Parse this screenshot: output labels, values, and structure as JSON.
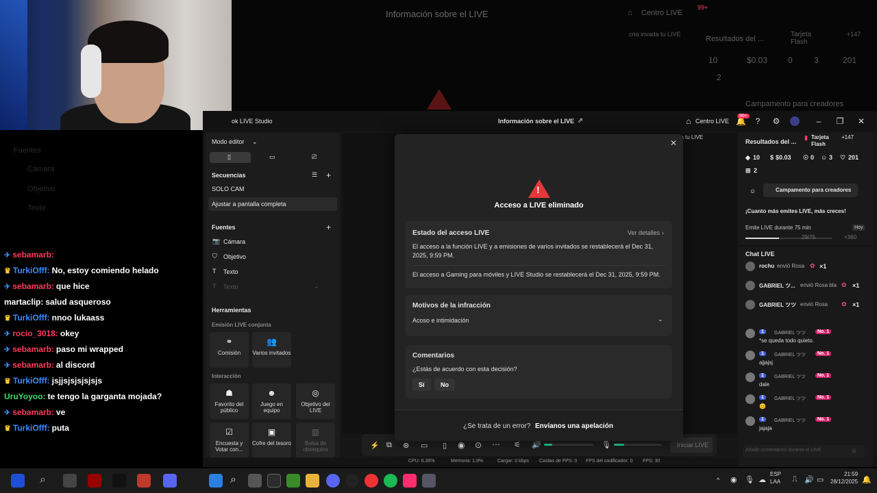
{
  "ghost": {
    "title": "Información sobre el LIVE",
    "centro": "Centro LIVE",
    "badge": "99+",
    "sub": "cria invada tu LIVE",
    "results": "Resultados del ...",
    "tarjeta": "Tarjeta Flash",
    "plus": "+147",
    "s1": "10",
    "s2": "$0.03",
    "s3": "0",
    "s4": "3",
    "s5": "201",
    "s6": "2",
    "camp": "Campamento para creadores"
  },
  "left_sources": {
    "title": "Fuentes",
    "items": [
      "Cámara",
      "Objetivo",
      "Texto"
    ]
  },
  "chat": [
    {
      "user": "sebamarb:",
      "msg": "",
      "icon": "✈",
      "color": "#ff3b5c"
    },
    {
      "user": "TurkiOfff:",
      "msg": "No, estoy comiendo helado",
      "icon": "♛",
      "color": "#3d8bff"
    },
    {
      "user": "sebamarb:",
      "msg": "que hice",
      "icon": "✈",
      "color": "#ff3b5c"
    },
    {
      "user": "martaclip:",
      "msg": "salud asqueroso",
      "icon": "",
      "color": "#ffffff"
    },
    {
      "user": "TurkiOfff:",
      "msg": "nnoo lukaass",
      "icon": "♛",
      "color": "#3d8bff"
    },
    {
      "user": "rocio_3018:",
      "msg": "okey",
      "icon": "✈",
      "color": "#ff3b5c"
    },
    {
      "user": "sebamarb:",
      "msg": "paso mi wrapped",
      "icon": "✈",
      "color": "#ff3b5c"
    },
    {
      "user": "sebamarb:",
      "msg": "al discord",
      "icon": "✈",
      "color": "#ff3b5c"
    },
    {
      "user": "TurkiOfff:",
      "msg": "jsjjsjsjsjsjsjs",
      "icon": "♛",
      "color": "#3d8bff"
    },
    {
      "user": "UruYoyoo:",
      "msg": "te tengo la garganta mojada?",
      "icon": "",
      "color": "#3ddc6b"
    },
    {
      "user": "sebamarb:",
      "msg": "ve",
      "icon": "✈",
      "color": "#ff3b5c"
    },
    {
      "user": "TurkiOfff:",
      "msg": "puta",
      "icon": "♛",
      "color": "#3d8bff"
    }
  ],
  "titlebar": {
    "app": "ok LIVE Studio",
    "center": "Información sobre el LIVE",
    "centro": "Centro LIVE",
    "badge": "99+"
  },
  "editor": {
    "mode": "Modo editor",
    "secuencias": "Secuencias",
    "solo": "SOLO CAM",
    "ajustar": "Ajustar a pantalla completa",
    "fuentes": "Fuentes",
    "sources": [
      "Cámara",
      "Objetivo",
      "Texto",
      "Texto"
    ]
  },
  "tools": {
    "title": "Herramientas",
    "joint": "Emisión LIVE conjunta",
    "comision": "Comisión",
    "varios": "Varios invitados",
    "interaccion": "Interacción",
    "favorito": "Favorito del público",
    "juego": "Juego en equipo",
    "objetivo": "Objetivo del LIVE",
    "encuesta": "Encuesta y Votar con...",
    "cofre": "Cofre del tesoro",
    "bolsa": "Bolsa de obsequios"
  },
  "modal": {
    "title": "Acceso a LIVE eliminado",
    "estado": "Estado del acceso LIVE",
    "ver": "Ver detalles",
    "p1": "El acceso a la función LIVE y a emisiones de varios invitados se restablecerá el Dec 31, 2025, 9:59 PM.",
    "p2": "El acceso a Gaming para móviles y LIVE Studio se restablecerá el Dec 31, 2025, 9:59 PM.",
    "motivos": "Motivos de la infracción",
    "acoso": "Acoso e intimidación",
    "comentarios": "Comentarios",
    "pregunta": "¿Estás de acuerdo con esta decisión?",
    "si": "Sí",
    "no": "No",
    "footer_q": "¿Se trata de un error?",
    "footer_a": "Envíanos una apelación"
  },
  "preview": {
    "banner": "legría invada tu LIVE",
    "start": "Iniciar LIVE"
  },
  "right": {
    "results": "Resultados del ...",
    "tarjeta": "Tarjeta Flash",
    "plus": "+147",
    "s1": "10",
    "s2": "$0.03",
    "s3": "0",
    "s4": "3",
    "s5": "201",
    "s6": "2",
    "camp": "Campamento para creadores",
    "promo": "¡Cuanto más emites LIVE, más creces!",
    "emite": "Emite LIVE durante 75 min",
    "hoy": "Hoy",
    "progress": "29/75",
    "progress_fraction": 0.39,
    "bonus": "×360",
    "chat_title": "Chat LIVE",
    "gifts": [
      {
        "user": "rochu",
        "text": "envió Rosa",
        "count": "×1"
      },
      {
        "user": "GABRIEL ツ...",
        "text": "envió Rosa bla",
        "count": "×1"
      },
      {
        "user": "GABRIEL ツツ",
        "text": "envió Rosa",
        "count": "×1"
      }
    ],
    "msgs": [
      {
        "user": "GABRIEL ツツ",
        "text": "*se queda todo quieto."
      },
      {
        "user": "GABRIEL ツツ",
        "text": "ajjajsj"
      },
      {
        "user": "GABRIEL ツツ",
        "text": "dale"
      },
      {
        "user": "GABRIEL ツツ",
        "text": "😊"
      },
      {
        "user": "GABRIEL ツツ",
        "text": "jajaja"
      }
    ],
    "lvl": "1",
    "no1": "No. 1",
    "input_placeholder": "Añadir comentarios durante el LIVE"
  },
  "status": {
    "cpu": "CPU: 6.35%",
    "mem": "Memoria: 1.9%",
    "carga": "Cargar: 0 kbps",
    "caidas": "Caídas de FPS: 0",
    "cod": "FPS del codificador: 0",
    "fps": "FPS: 30"
  },
  "taskbar": {
    "lang1": "ESP",
    "lang2": "LAA",
    "time": "21:59",
    "date": "28/12/2025"
  }
}
